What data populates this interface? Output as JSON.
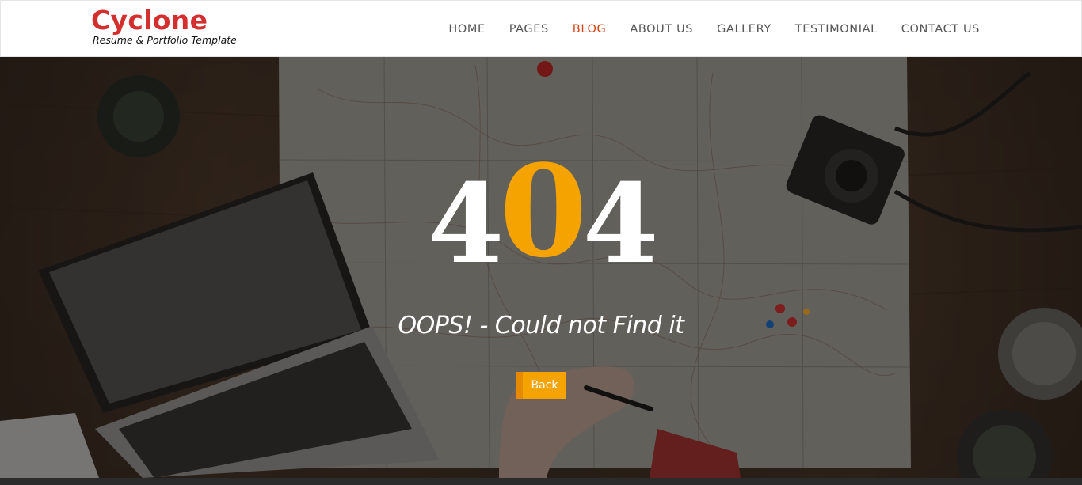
{
  "brand": {
    "title": "Cyclone",
    "tagline": "Resume & Portfolio Template",
    "color": "#d32f2f"
  },
  "nav": {
    "items": [
      {
        "label": "HOME",
        "active": false
      },
      {
        "label": "PAGES",
        "active": false
      },
      {
        "label": "BLOG",
        "active": true
      },
      {
        "label": "ABOUT US",
        "active": false
      },
      {
        "label": "GALLERY",
        "active": false
      },
      {
        "label": "TESTIMONIAL",
        "active": false
      },
      {
        "label": "CONTACT US",
        "active": false
      }
    ],
    "active_color": "#d84315"
  },
  "error": {
    "digit_1": "4",
    "digit_2": "0",
    "digit_3": "4",
    "accent_color": "#f5a300",
    "message": "OOPS! - Could not Find it",
    "back_label": "Back"
  }
}
